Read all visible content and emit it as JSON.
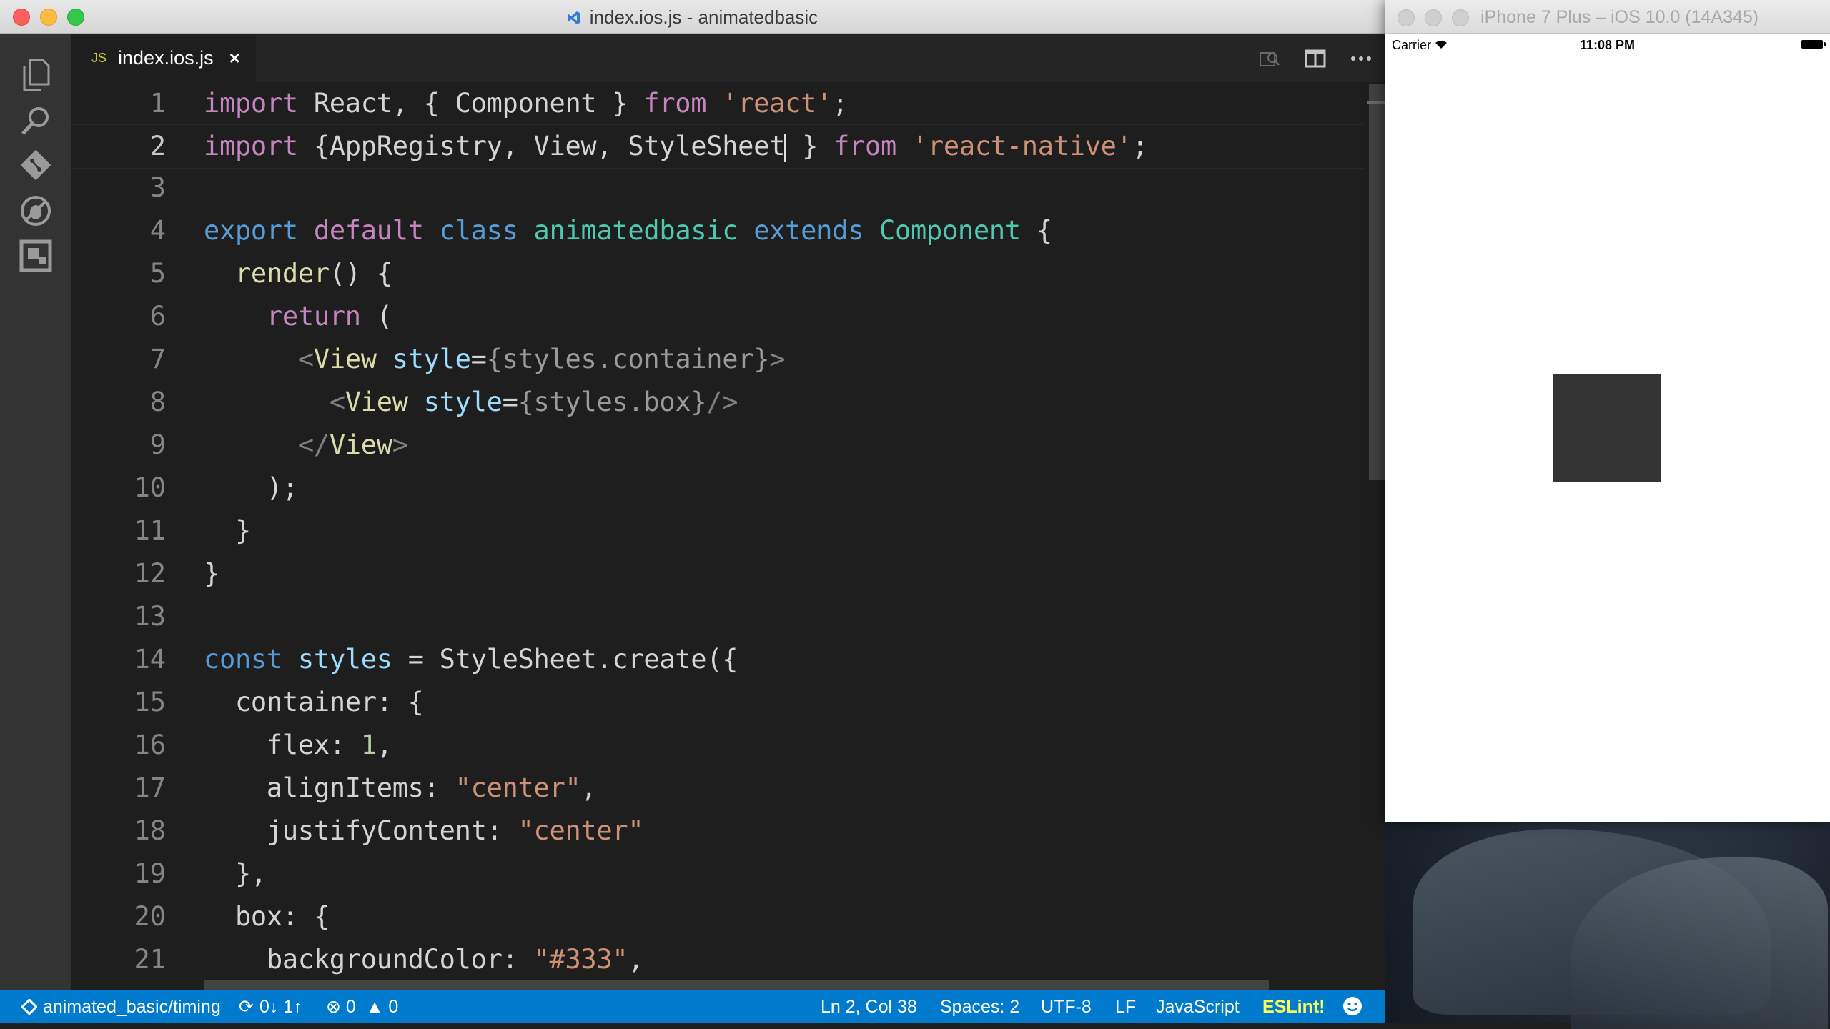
{
  "vscode": {
    "window_title": "index.ios.js - animatedbasic",
    "tab": {
      "badge": "JS",
      "name": "index.ios.js",
      "close": "×"
    },
    "code_lines": [
      {
        "num": "1"
      },
      {
        "num": "2"
      },
      {
        "num": "3"
      },
      {
        "num": "4"
      },
      {
        "num": "5"
      },
      {
        "num": "6"
      },
      {
        "num": "7"
      },
      {
        "num": "8"
      },
      {
        "num": "9"
      },
      {
        "num": "10"
      },
      {
        "num": "11"
      },
      {
        "num": "12"
      },
      {
        "num": "13"
      },
      {
        "num": "14"
      },
      {
        "num": "15"
      },
      {
        "num": "16"
      },
      {
        "num": "17"
      },
      {
        "num": "18"
      },
      {
        "num": "19"
      },
      {
        "num": "20"
      },
      {
        "num": "21"
      }
    ],
    "tokens": {
      "l1": [
        "import",
        " React, { Component } ",
        "from",
        " ",
        "'react'",
        ";"
      ],
      "l2a": [
        "import",
        " {AppRegistry, View, StyleSheet"
      ],
      "l2b": [
        " } ",
        "from",
        " ",
        "'react-native'",
        ";"
      ],
      "l4": [
        "export",
        " ",
        "default",
        " ",
        "class",
        " ",
        "animatedbasic",
        " ",
        "extends",
        " ",
        "Component",
        " {"
      ],
      "l5": [
        "  ",
        "render",
        "() {"
      ],
      "l6": [
        "    ",
        "return",
        " ("
      ],
      "l7": [
        "      ",
        "<",
        "View",
        " ",
        "style",
        "=",
        "{styles.container}",
        ">"
      ],
      "l8": [
        "        ",
        "<",
        "View",
        " ",
        "style",
        "=",
        "{styles.box}",
        "/>"
      ],
      "l9": [
        "      ",
        "</",
        "View",
        ">"
      ],
      "l10": [
        "    );"
      ],
      "l11": [
        "  }"
      ],
      "l12": [
        "}"
      ],
      "l14": [
        "const",
        " ",
        "styles",
        " = StyleSheet.create({"
      ],
      "l15": [
        "  container: {"
      ],
      "l16": [
        "    flex: ",
        "1",
        ","
      ],
      "l17": [
        "    alignItems: ",
        "\"center\"",
        ","
      ],
      "l18": [
        "    justifyContent: ",
        "\"center\""
      ],
      "l19": [
        "  },"
      ],
      "l20": [
        "  box: {"
      ],
      "l21": [
        "    backgroundColor: ",
        "\"#333\"",
        ","
      ]
    },
    "status": {
      "branch": "animated_basic/timing",
      "sync": "0↓ 1↑",
      "errors": "0",
      "warnings": "0",
      "position": "Ln 2, Col 38",
      "spaces": "Spaces: 2",
      "encoding": "UTF-8",
      "eol": "LF",
      "language": "JavaScript",
      "eslint": "ESLint!"
    },
    "activity_icons": [
      "files-icon",
      "search-icon",
      "git-icon",
      "debug-icon",
      "extensions-icon"
    ],
    "colors": {
      "statusbar": "#007acc",
      "editor_bg": "#1e1e1e",
      "activitybar": "#333333"
    }
  },
  "simulator": {
    "title": "iPhone 7 Plus – iOS 10.0 (14A345)",
    "carrier": "Carrier",
    "time": "11:08 PM",
    "box_color": "#333333"
  }
}
